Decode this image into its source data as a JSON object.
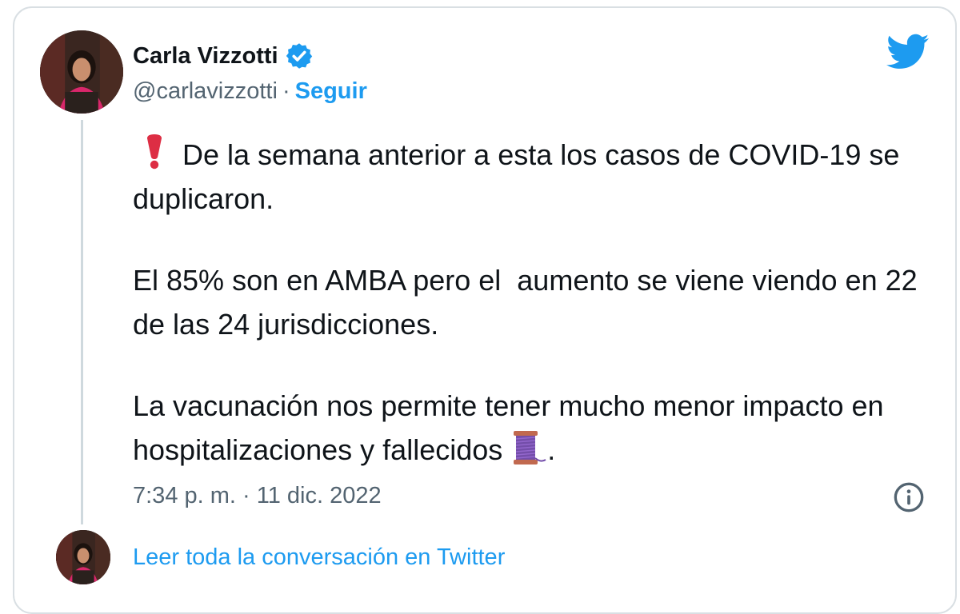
{
  "author": {
    "name": "Carla Vizzotti",
    "handle": "@carlavizzotti",
    "separator": "·",
    "follow_label": "Seguir"
  },
  "tweet": {
    "paragraphs": [
      "De la semana anterior a esta los casos de COVID-19 se duplicaron.",
      "El 85% son en AMBA pero el  aumento se viene viendo en 22 de las 24 jurisdicciones.",
      "La vacunación nos permite tener mucho menor impacto en hospitalizaciones y fallecidos"
    ],
    "trailing_punctuation": ".",
    "timestamp": "7:34 p. m. · 11 dic. 2022"
  },
  "footer": {
    "read_conversation_label": "Leer toda la conversación en Twitter"
  },
  "icons": {
    "verified": "verified-badge-icon",
    "brand": "twitter-bird-icon",
    "exclamation": "red-exclamation-emoji",
    "thread": "spool-of-thread-emoji",
    "info": "info-icon"
  },
  "colors": {
    "link": "#1d9bf0",
    "secondary_text": "#536471",
    "border": "#d9dfe3",
    "thread_line": "#cfd9de"
  }
}
